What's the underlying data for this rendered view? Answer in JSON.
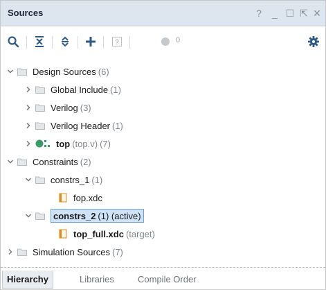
{
  "panel": {
    "title": "Sources",
    "controls": {
      "help": "?",
      "minimize": "_",
      "maximize": "☐",
      "restore": "⇱",
      "close": "✕"
    }
  },
  "toolbar": {
    "messages_count": "0"
  },
  "tree": {
    "design_sources": {
      "label": "Design Sources",
      "count": "(6)"
    },
    "global_include": {
      "label": "Global Include",
      "count": "(1)"
    },
    "verilog": {
      "label": "Verilog",
      "count": "(3)"
    },
    "verilog_header": {
      "label": "Verilog Header",
      "count": "(1)"
    },
    "top": {
      "label": "top",
      "file": "(top.v)",
      "count": "(7)"
    },
    "constraints": {
      "label": "Constraints",
      "count": "(2)"
    },
    "constrs_1": {
      "label": "constrs_1",
      "count": "(1)"
    },
    "fop_xdc": {
      "label": "fop.xdc"
    },
    "constrs_2": {
      "label": "constrs_2",
      "count": "(1) (active)"
    },
    "top_full_xdc": {
      "label": "top_full.xdc",
      "note": "(target)"
    },
    "simulation_sources": {
      "label": "Simulation Sources",
      "count": "(7)"
    }
  },
  "tabs": [
    {
      "label": "Hierarchy"
    },
    {
      "label": "Libraries"
    },
    {
      "label": "Compile Order"
    }
  ],
  "colors": {
    "titlebar": "#dde6ef",
    "selection": "#cfe3f7",
    "selection_border": "#6fa3d8",
    "icon_blue": "#2e5a8a",
    "top_module_green": "#3a9a6a",
    "xdc_orange": "#e08a1e"
  }
}
